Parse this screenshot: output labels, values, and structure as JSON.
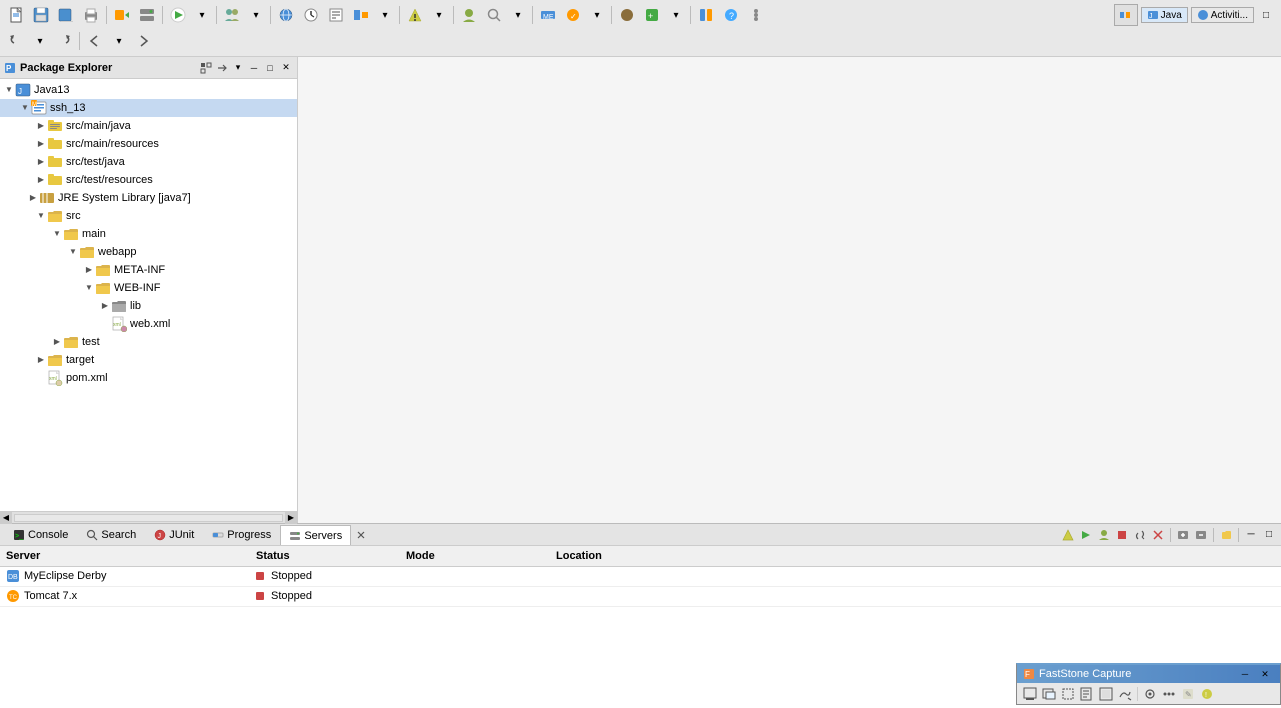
{
  "toolbar": {
    "row1_buttons": [
      "new",
      "save",
      "save-all",
      "print",
      "sep",
      "run",
      "debug",
      "sep",
      "team",
      "sep",
      "search",
      "sep",
      "servers",
      "sep",
      "open-task",
      "sep",
      "open-type"
    ],
    "row2_buttons": [
      "undo",
      "redo",
      "sep",
      "back",
      "forward"
    ],
    "java_label": "Java",
    "activities_label": "Activiti..."
  },
  "package_explorer": {
    "title": "Package Explorer",
    "tree": [
      {
        "id": "java13",
        "label": "Java13",
        "level": 0,
        "expanded": true,
        "icon": "project"
      },
      {
        "id": "ssh13",
        "label": "ssh_13",
        "level": 1,
        "expanded": true,
        "icon": "project-ssh",
        "selected": true
      },
      {
        "id": "srcmainjava",
        "label": "src/main/java",
        "level": 2,
        "expanded": false,
        "icon": "source-folder"
      },
      {
        "id": "srcmainresources",
        "label": "src/main/resources",
        "level": 2,
        "expanded": false,
        "icon": "source-folder"
      },
      {
        "id": "srctestjava",
        "label": "src/test/java",
        "level": 2,
        "expanded": false,
        "icon": "source-folder"
      },
      {
        "id": "srctestresources",
        "label": "src/test/resources",
        "level": 2,
        "expanded": false,
        "icon": "source-folder"
      },
      {
        "id": "jrelibrary",
        "label": "JRE System Library [java7]",
        "level": 2,
        "expanded": false,
        "icon": "library"
      },
      {
        "id": "src",
        "label": "src",
        "level": 2,
        "expanded": true,
        "icon": "folder"
      },
      {
        "id": "main",
        "label": "main",
        "level": 3,
        "expanded": true,
        "icon": "folder"
      },
      {
        "id": "webapp",
        "label": "webapp",
        "level": 4,
        "expanded": true,
        "icon": "folder"
      },
      {
        "id": "metainf",
        "label": "META-INF",
        "level": 5,
        "expanded": false,
        "icon": "folder"
      },
      {
        "id": "webinf",
        "label": "WEB-INF",
        "level": 5,
        "expanded": true,
        "icon": "folder"
      },
      {
        "id": "lib",
        "label": "lib",
        "level": 6,
        "expanded": false,
        "icon": "folder"
      },
      {
        "id": "webxml",
        "label": "web.xml",
        "level": 6,
        "expanded": false,
        "icon": "xml-file"
      },
      {
        "id": "test",
        "label": "test",
        "level": 3,
        "expanded": false,
        "icon": "folder"
      },
      {
        "id": "target",
        "label": "target",
        "level": 2,
        "expanded": false,
        "icon": "folder"
      },
      {
        "id": "pomxml",
        "label": "pom.xml",
        "level": 2,
        "expanded": false,
        "icon": "xml-file"
      }
    ]
  },
  "bottom_panel": {
    "tabs": [
      {
        "id": "console",
        "label": "Console",
        "icon": "console-icon",
        "active": false
      },
      {
        "id": "search",
        "label": "Search",
        "icon": "search-icon",
        "active": false
      },
      {
        "id": "junit",
        "label": "JUnit",
        "icon": "junit-icon",
        "active": false
      },
      {
        "id": "progress",
        "label": "Progress",
        "icon": "progress-icon",
        "active": false
      },
      {
        "id": "servers",
        "label": "Servers",
        "icon": "servers-icon",
        "active": true
      }
    ],
    "servers_table": {
      "columns": [
        "Server",
        "Status",
        "Mode",
        "Location"
      ],
      "rows": [
        {
          "server": "MyEclipse Derby",
          "status": "Stopped",
          "mode": "",
          "location": ""
        },
        {
          "server": "Tomcat  7.x",
          "status": "Stopped",
          "mode": "",
          "location": ""
        }
      ]
    }
  },
  "faststone": {
    "title": "FastStone Capture",
    "buttons": [
      "screen-capture",
      "window-capture",
      "region-capture",
      "scrolling-capture",
      "fullscreen",
      "settings",
      "minimize",
      "close"
    ]
  }
}
